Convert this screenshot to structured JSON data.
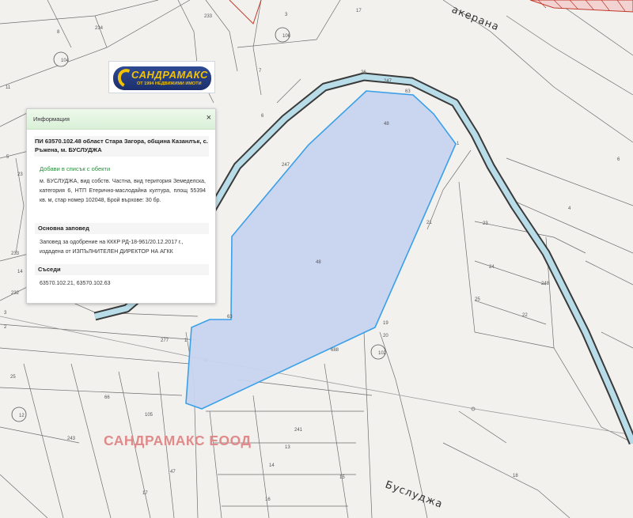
{
  "map": {
    "road_names": [
      "акерана",
      "Буслуджа"
    ],
    "parcel_labels": [
      "233",
      "234",
      "8",
      "106",
      "7",
      "104",
      "26",
      "247",
      "63",
      "48",
      "6",
      "5",
      "4",
      "247",
      "1",
      "21",
      "23",
      "24",
      "25",
      "22",
      "23",
      "233",
      "14",
      "232",
      "248",
      "3",
      "2",
      "48",
      "63",
      "277",
      "1",
      "19",
      "20",
      "102",
      "688",
      "25",
      "66",
      "12",
      "105",
      "243",
      "241",
      "13",
      "14",
      "16",
      "15",
      "18",
      "47",
      "17",
      "16",
      "8",
      "6",
      "17",
      "11",
      "3"
    ],
    "watermark": "САНДРАМАКС ЕООД",
    "colors": {
      "parcel_fill": "#c7d3ee",
      "parcel_border": "#3aa0e8",
      "road_casing": "#3a3a3a",
      "road_fill": "#b8dce8",
      "watermark": "#e08a8a"
    }
  },
  "logo": {
    "title": "САНДРАМАКС",
    "subtitle": "ОТ 1994 НЕДВИЖИМИ ИМОТИ"
  },
  "panel": {
    "title": "Информация",
    "close": "×",
    "heading": "ПИ 63570.102.48 област Стара Загора, община Казанлък, с. Ръжена, м. БУСЛУДЖА",
    "add_link": "Добави в списък с обекти",
    "description": "м. БУСЛУДЖА, вид собств. Частна, вид територия Земеделска, категория 6, НТП Етерично-маслодайна култура, площ 55394 кв. м, стар номер 102048, Брой върхове: 30 бр.",
    "order_title": "Основна заповед",
    "order_text": "Заповед за одобрение на КККР РД-18-961/20.12.2017 г., издадена от ИЗПЪЛНИТЕЛЕН ДИРЕКТОР НА АГКК",
    "neighbors_title": "Съседи",
    "neighbors_text": "63570.102.21, 63570.102.63"
  }
}
